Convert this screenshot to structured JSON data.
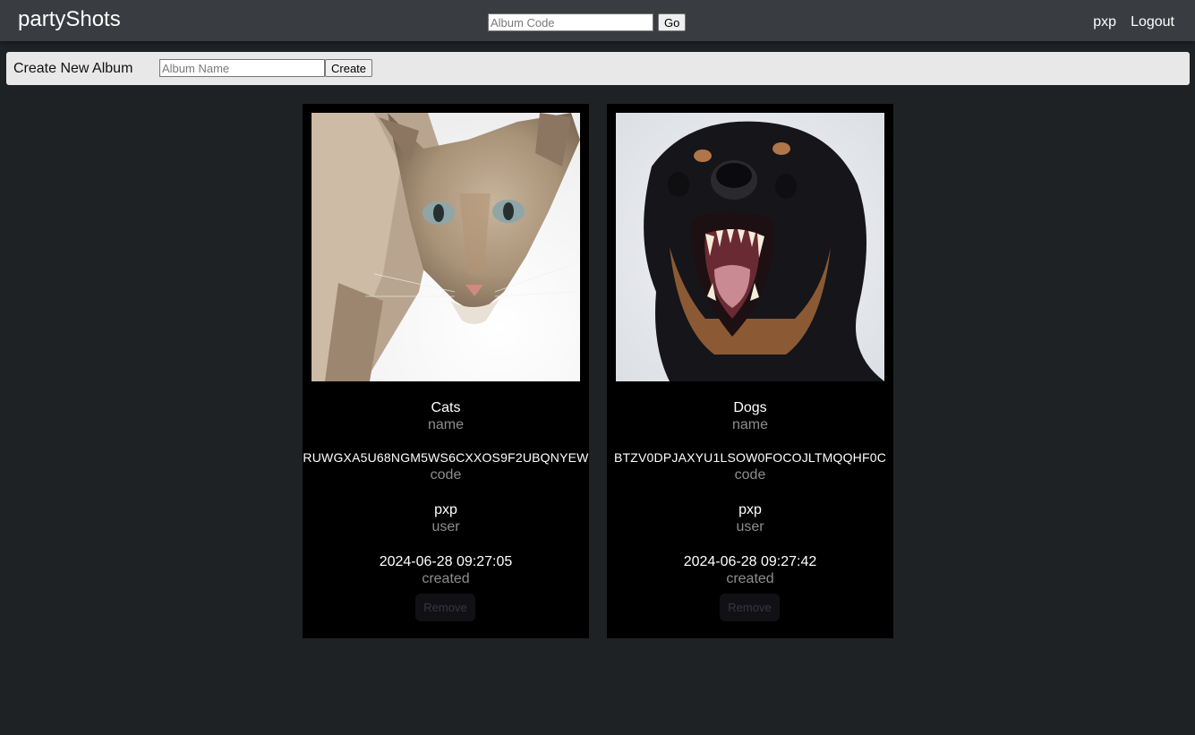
{
  "header": {
    "brand": "partyShots",
    "album_code_placeholder": "Album Code",
    "go_label": "Go",
    "username": "pxp",
    "logout_label": "Logout"
  },
  "create_album": {
    "title": "Create New Album",
    "name_placeholder": "Album Name",
    "create_label": "Create"
  },
  "albums": [
    {
      "image_subject": "cat",
      "name": "Cats",
      "name_label": "name",
      "code": "RUWGXA5U68NGM5WS6CXXOS9F2UBQNYEW",
      "code_label": "code",
      "user": "pxp",
      "user_label": "user",
      "created": "2024-06-28 09:27:05",
      "created_label": "created",
      "remove_label": "Remove"
    },
    {
      "image_subject": "dog",
      "name": "Dogs",
      "name_label": "name",
      "code": "BTZV0DPJAXYU1LSOW0FOCOJLTMQQHF0C",
      "code_label": "code",
      "user": "pxp",
      "user_label": "user",
      "created": "2024-06-28 09:27:42",
      "created_label": "created",
      "remove_label": "Remove"
    }
  ]
}
